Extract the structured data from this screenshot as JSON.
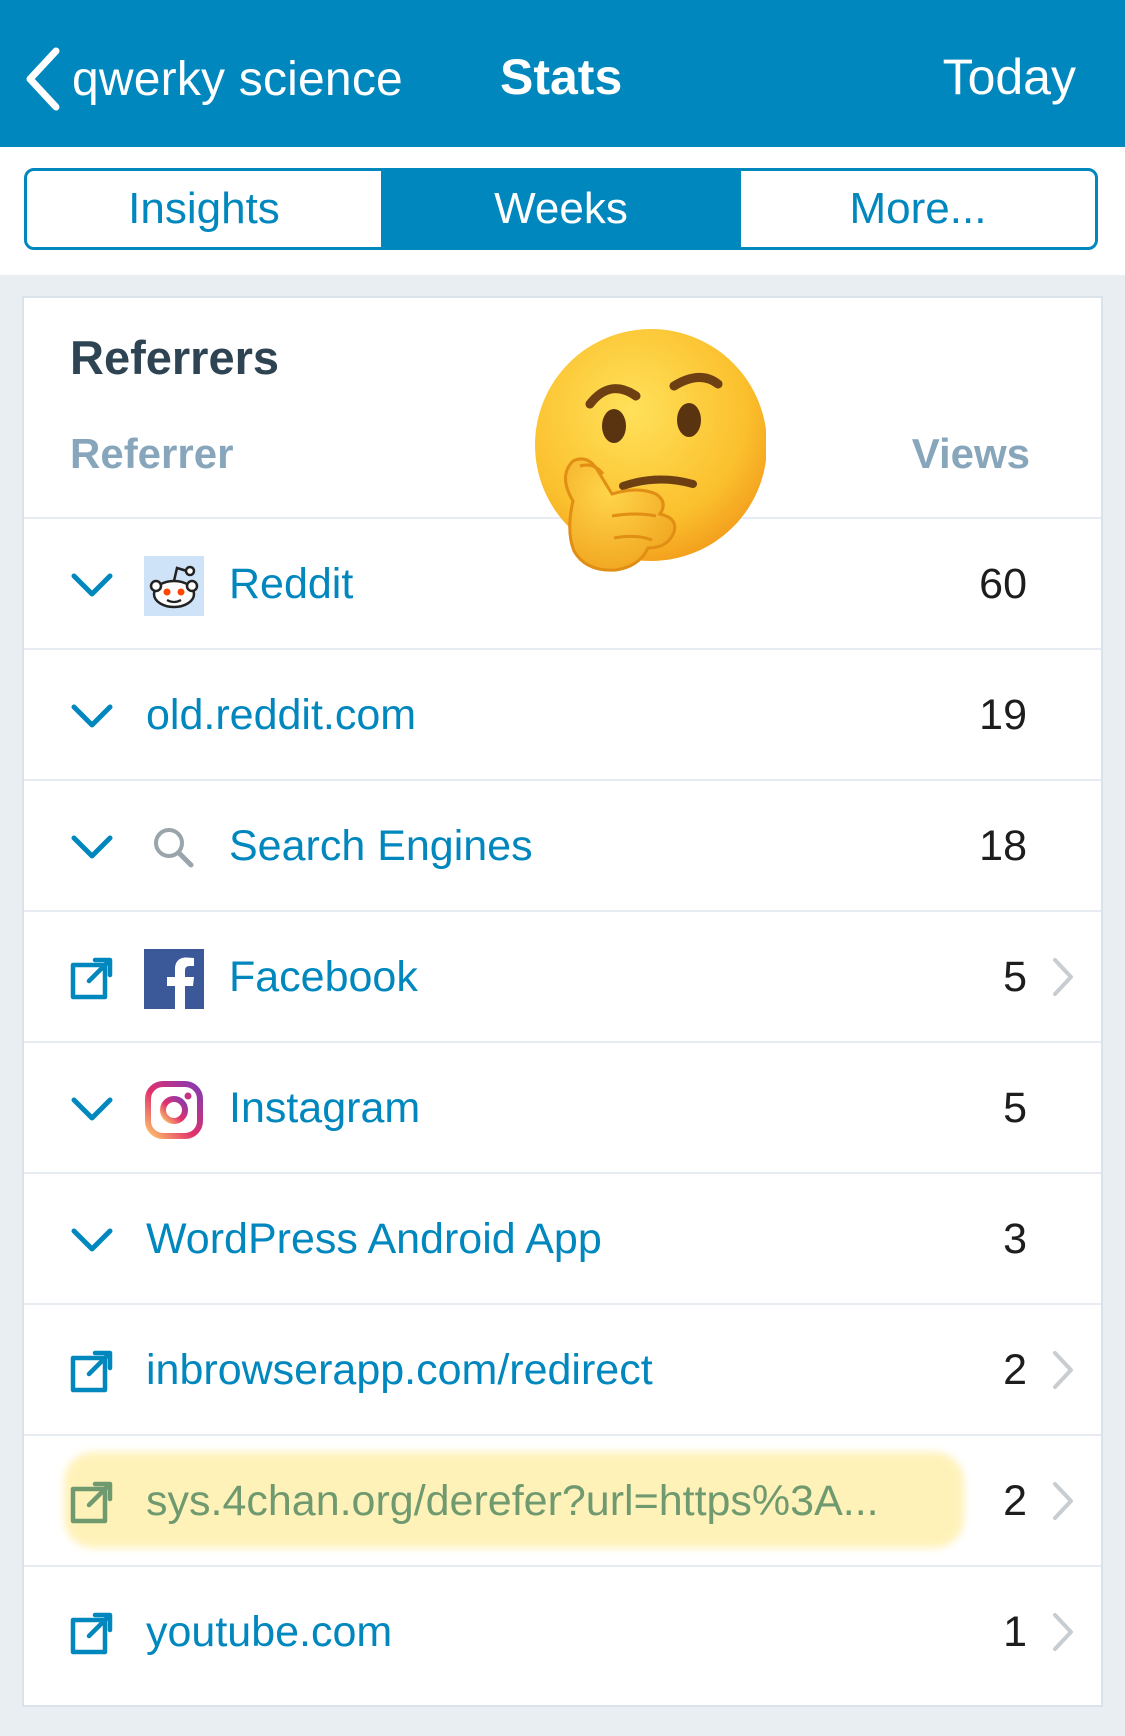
{
  "nav": {
    "back_label": "qwerky science",
    "title": "Stats",
    "right_label": "Today"
  },
  "tabs": [
    {
      "label": "Insights",
      "active": false
    },
    {
      "label": "Weeks",
      "active": true
    },
    {
      "label": "More...",
      "active": false
    }
  ],
  "card": {
    "title": "Referrers",
    "col_referrer": "Referrer",
    "col_views": "Views"
  },
  "rows": [
    {
      "label": "Reddit",
      "views": "60",
      "lead": "chevron-down",
      "favicon": "reddit-icon"
    },
    {
      "label": "old.reddit.com",
      "views": "19",
      "lead": "chevron-down",
      "favicon": ""
    },
    {
      "label": "Search Engines",
      "views": "18",
      "lead": "chevron-down",
      "favicon": "search-icon"
    },
    {
      "label": "Facebook",
      "views": "5",
      "lead": "external-link",
      "favicon": "facebook-icon",
      "disclosure": true
    },
    {
      "label": "Instagram",
      "views": "5",
      "lead": "chevron-down",
      "favicon": "instagram-icon"
    },
    {
      "label": "WordPress Android App",
      "views": "3",
      "lead": "chevron-down",
      "favicon": ""
    },
    {
      "label": "inbrowserapp.com/redirect",
      "views": "2",
      "lead": "external-link",
      "favicon": "",
      "disclosure": true
    },
    {
      "label": "sys.4chan.org/derefer?url=https%3A...",
      "views": "2",
      "lead": "external-link",
      "favicon": "",
      "disclosure": true,
      "highlighted": true
    },
    {
      "label": "youtube.com",
      "views": "1",
      "lead": "external-link",
      "favicon": "",
      "disclosure": true
    }
  ],
  "colors": {
    "primary": "#0087be",
    "heading": "#2e4453",
    "subheading": "#87a6bc",
    "highlight": "#ffe264"
  },
  "overlay": {
    "emoji": "thinking-face-icon"
  }
}
